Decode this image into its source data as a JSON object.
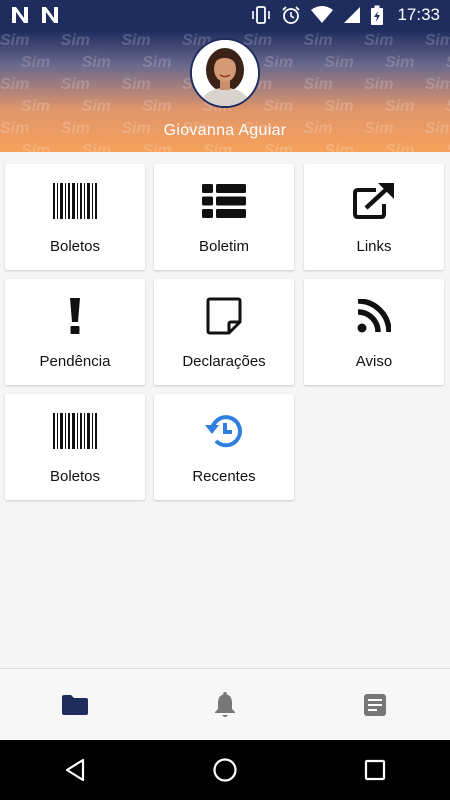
{
  "status_bar": {
    "time": "17:33",
    "icons": [
      "n-notification-icon",
      "n-notification-icon",
      "vibrate-icon",
      "alarm-icon",
      "wifi-icon",
      "signal-icon",
      "battery-charging-icon"
    ]
  },
  "header": {
    "user_name": "Giovanna Aguiar",
    "watermark_text": "Sim",
    "avatar": "user-avatar"
  },
  "tiles": [
    {
      "label": "Boletos",
      "icon": "barcode-icon"
    },
    {
      "label": "Boletim",
      "icon": "list-icon"
    },
    {
      "label": "Links",
      "icon": "external-link-icon"
    },
    {
      "label": "Pendência",
      "icon": "exclamation-icon"
    },
    {
      "label": "Declarações",
      "icon": "note-icon"
    },
    {
      "label": "Aviso",
      "icon": "rss-icon"
    },
    {
      "label": "Boletos",
      "icon": "barcode-icon"
    },
    {
      "label": "Recentes",
      "icon": "history-icon"
    }
  ],
  "bottom_nav": [
    {
      "icon": "folder-icon",
      "active": true
    },
    {
      "icon": "bell-icon",
      "active": false
    },
    {
      "icon": "document-icon",
      "active": false
    }
  ],
  "system_nav": [
    "back-icon",
    "home-icon",
    "recents-icon"
  ],
  "colors": {
    "primary": "#1e2c5e",
    "accent_orange": "#f6a15b",
    "recentes_blue": "#2f7fe0",
    "inactive_icon": "#777777"
  }
}
